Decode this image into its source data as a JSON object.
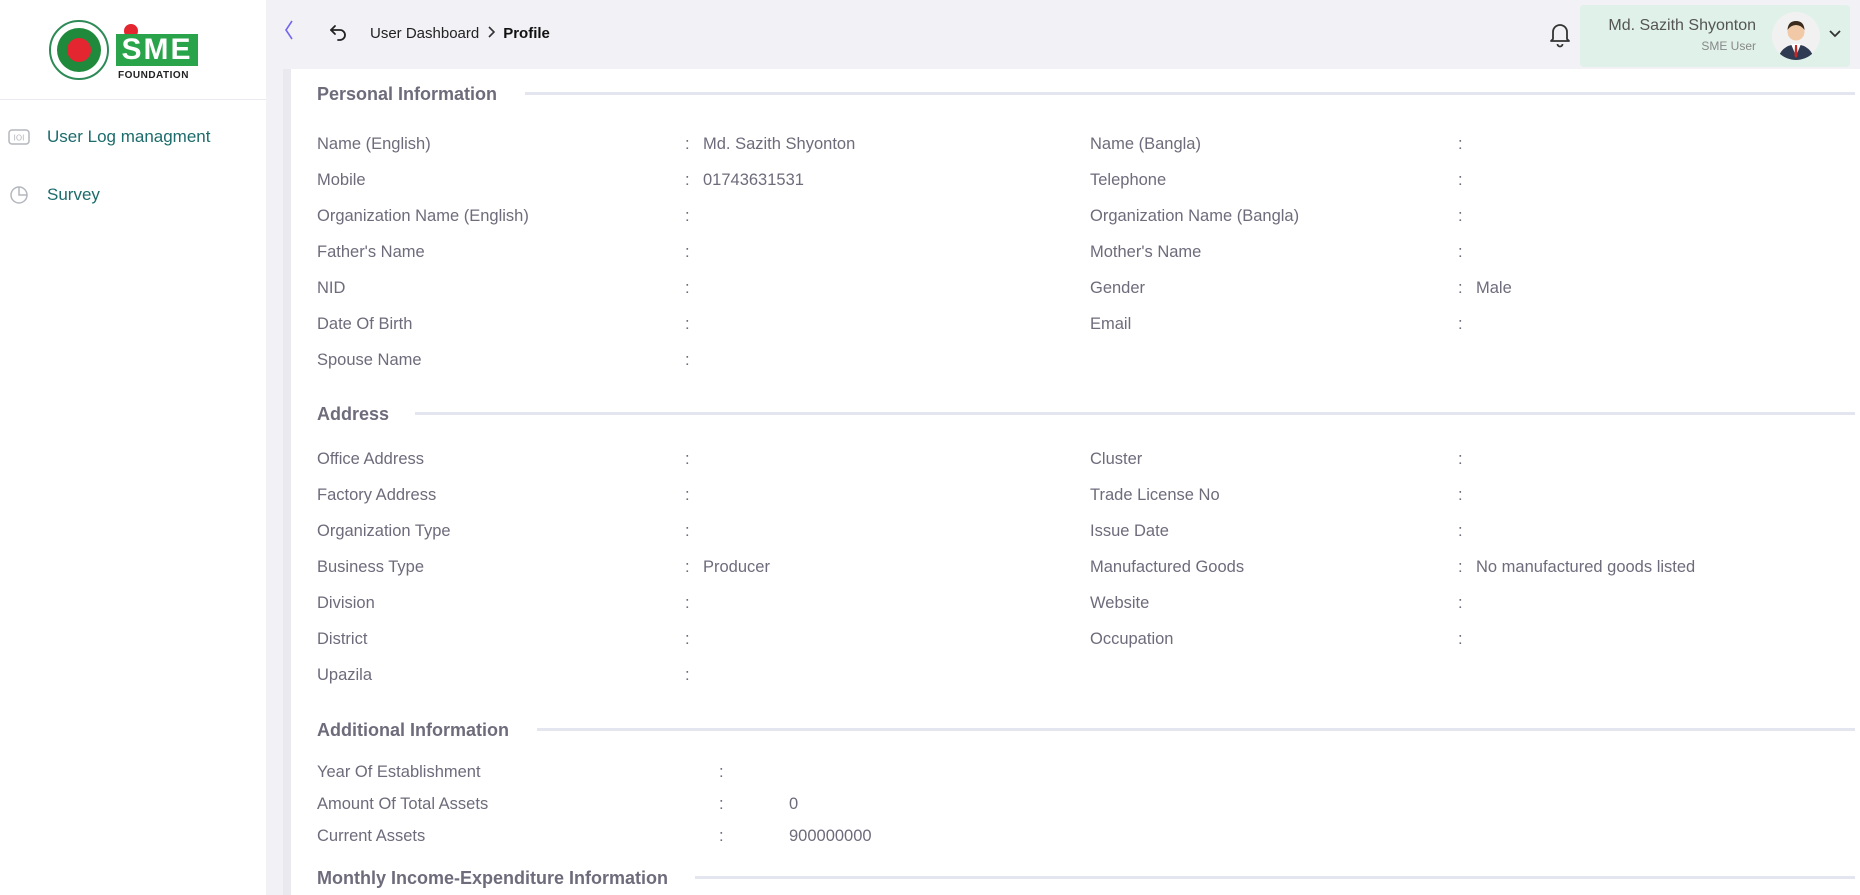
{
  "brand": {
    "logo_word": "SME",
    "logo_sub": "FOUNDATION"
  },
  "sidebar": {
    "items": [
      {
        "label": "User Log managment",
        "icon": "log-icon"
      },
      {
        "label": "Survey",
        "icon": "pie-chart-icon"
      }
    ]
  },
  "header": {
    "breadcrumb": {
      "parent": "User Dashboard",
      "current": "Profile"
    },
    "user": {
      "name": "Md. Sazith Shyonton",
      "role": "SME User"
    }
  },
  "personal": {
    "title": "Personal Information",
    "fields": {
      "name_en": {
        "label": "Name (English)",
        "value": "Md. Sazith Shyonton"
      },
      "name_bn": {
        "label": "Name (Bangla)",
        "value": ""
      },
      "mobile": {
        "label": "Mobile",
        "value": "01743631531"
      },
      "telephone": {
        "label": "Telephone",
        "value": ""
      },
      "org_en": {
        "label": "Organization Name (English)",
        "value": ""
      },
      "org_bn": {
        "label": "Organization Name (Bangla)",
        "value": ""
      },
      "father": {
        "label": "Father's Name",
        "value": ""
      },
      "mother": {
        "label": "Mother's Name",
        "value": ""
      },
      "nid": {
        "label": "NID",
        "value": ""
      },
      "gender": {
        "label": "Gender",
        "value": "Male"
      },
      "dob": {
        "label": "Date Of Birth",
        "value": ""
      },
      "email": {
        "label": "Email",
        "value": ""
      },
      "spouse": {
        "label": "Spouse Name",
        "value": ""
      }
    }
  },
  "address": {
    "title": "Address",
    "fields": {
      "office": {
        "label": "Office Address",
        "value": ""
      },
      "cluster": {
        "label": "Cluster",
        "value": ""
      },
      "factory": {
        "label": "Factory Address",
        "value": ""
      },
      "trade": {
        "label": "Trade License No",
        "value": ""
      },
      "orgtype": {
        "label": "Organization Type",
        "value": ""
      },
      "issue": {
        "label": "Issue Date",
        "value": ""
      },
      "business": {
        "label": "Business Type",
        "value": "Producer"
      },
      "goods": {
        "label": "Manufactured Goods",
        "value": "No manufactured goods listed"
      },
      "division": {
        "label": "Division",
        "value": ""
      },
      "website": {
        "label": "Website",
        "value": ""
      },
      "district": {
        "label": "District",
        "value": ""
      },
      "occupation": {
        "label": "Occupation",
        "value": ""
      },
      "upazila": {
        "label": "Upazila",
        "value": ""
      }
    }
  },
  "additional": {
    "title": "Additional Information",
    "fields": {
      "year": {
        "label": "Year Of Establishment",
        "value": ""
      },
      "total_assets": {
        "label": "Amount Of Total Assets",
        "value": "0"
      },
      "current_assets": {
        "label": "Current Assets",
        "value": "900000000"
      }
    }
  },
  "monthly": {
    "title": "Monthly Income-Expenditure Information"
  },
  "colon": ":"
}
